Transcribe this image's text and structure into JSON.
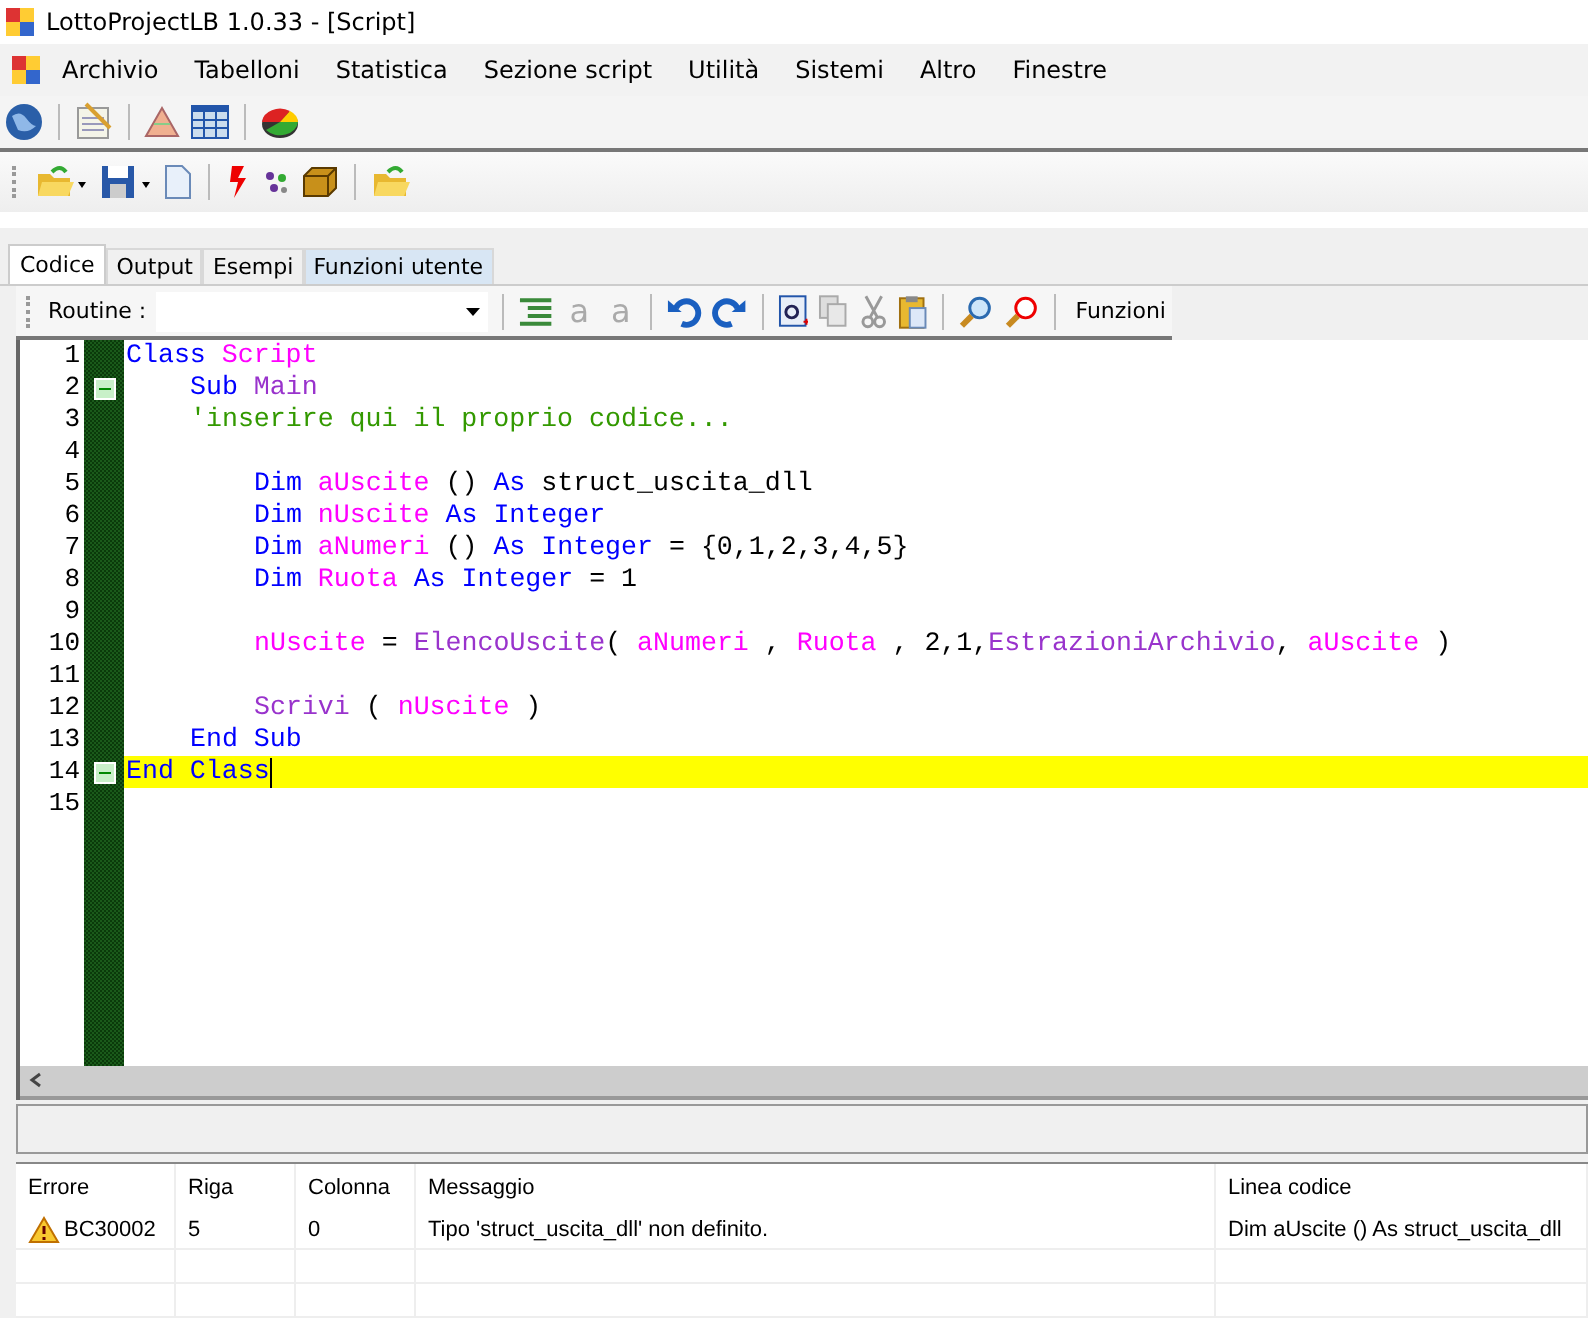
{
  "window": {
    "title": "LottoProjectLB 1.0.33 - [Script]"
  },
  "menu": [
    "Archivio",
    "Tabelloni",
    "Statistica",
    "Sezione script",
    "Utilità",
    "Sistemi",
    "Altro",
    "Finestre"
  ],
  "tabs": [
    {
      "label": "Codice",
      "selected": true,
      "highlighted": false
    },
    {
      "label": "Output",
      "selected": false,
      "highlighted": false
    },
    {
      "label": "Esempi",
      "selected": false,
      "highlighted": false
    },
    {
      "label": "Funzioni utente",
      "selected": false,
      "highlighted": true
    }
  ],
  "editor_toolbar": {
    "routine_label": "Routine :",
    "letter_buttons": [
      {
        "glyph": "a",
        "disabled": true
      },
      {
        "glyph": "a",
        "disabled": true
      }
    ],
    "functions_button": "Funzioni"
  },
  "editor": {
    "lines": [
      {
        "number": "1",
        "fold": false,
        "current": false,
        "tokens": [
          {
            "kind": "keyword",
            "text": "Class "
          },
          {
            "kind": "ident",
            "text": "Script"
          }
        ],
        "children": [
          {
            "number": "2",
            "fold": true,
            "current": false,
            "tokens": [
              {
                "kind": "keyword",
                "text": "Sub "
              },
              {
                "kind": "func",
                "text": "Main"
              }
            ]
          },
          {
            "number": "3",
            "fold": false,
            "current": false,
            "tokens": [
              {
                "kind": "comment",
                "text": "'inserire qui il proprio codice..."
              }
            ],
            "children": [
              {
                "number": "4",
                "fold": false,
                "current": false
              },
              {
                "number": "5",
                "fold": false,
                "current": false,
                "tokens": [
                  {
                    "kind": "keyword",
                    "text": "Dim "
                  },
                  {
                    "kind": "ident",
                    "text": "aUscite"
                  },
                  {
                    "kind": "plain",
                    "text": " () "
                  },
                  {
                    "kind": "keyword",
                    "text": "As "
                  },
                  {
                    "kind": "plain",
                    "text": "struct_uscita_dll"
                  }
                ]
              },
              {
                "number": "6",
                "fold": false,
                "current": false,
                "tokens": [
                  {
                    "kind": "keyword",
                    "text": "Dim "
                  },
                  {
                    "kind": "ident",
                    "text": "nUscite "
                  },
                  {
                    "kind": "keyword",
                    "text": "As Integer"
                  }
                ]
              },
              {
                "number": "7",
                "fold": false,
                "current": false,
                "tokens": [
                  {
                    "kind": "keyword",
                    "text": "Dim "
                  },
                  {
                    "kind": "ident",
                    "text": "aNumeri"
                  },
                  {
                    "kind": "plain",
                    "text": " () "
                  },
                  {
                    "kind": "keyword",
                    "text": "As Integer"
                  },
                  {
                    "kind": "plain",
                    "text": " = {0,1,2,3,4,5}"
                  }
                ]
              },
              {
                "number": "8",
                "fold": false,
                "current": false,
                "tokens": [
                  {
                    "kind": "keyword",
                    "text": "Dim "
                  },
                  {
                    "kind": "ident",
                    "text": "Ruota "
                  },
                  {
                    "kind": "keyword",
                    "text": "As Integer"
                  },
                  {
                    "kind": "plain",
                    "text": " = 1"
                  }
                ]
              },
              {
                "number": "9",
                "fold": false,
                "current": false
              },
              {
                "number": "10",
                "fold": false,
                "current": false,
                "tokens": [
                  {
                    "kind": "ident",
                    "text": "nUscite"
                  },
                  {
                    "kind": "plain",
                    "text": " = "
                  },
                  {
                    "kind": "func",
                    "text": "ElencoUscite"
                  },
                  {
                    "kind": "plain",
                    "text": "( "
                  },
                  {
                    "kind": "ident",
                    "text": "aNumeri"
                  },
                  {
                    "kind": "plain",
                    "text": " , "
                  },
                  {
                    "kind": "ident",
                    "text": "Ruota"
                  },
                  {
                    "kind": "plain",
                    "text": " , 2,1,"
                  },
                  {
                    "kind": "func",
                    "text": "EstrazioniArchivio"
                  },
                  {
                    "kind": "plain",
                    "text": ", "
                  },
                  {
                    "kind": "ident",
                    "text": "aUscite"
                  },
                  {
                    "kind": "plain",
                    "text": " )"
                  }
                ]
              },
              {
                "number": "11",
                "fold": false,
                "current": false
              },
              {
                "number": "12",
                "fold": false,
                "current": false,
                "tokens": [
                  {
                    "kind": "func",
                    "text": "Scrivi"
                  },
                  {
                    "kind": "plain",
                    "text": " ( "
                  },
                  {
                    "kind": "ident",
                    "text": "nUscite"
                  },
                  {
                    "kind": "plain",
                    "text": " )"
                  }
                ]
              }
            ]
          },
          {
            "number": "13",
            "fold": false,
            "current": false,
            "tokens": [
              {
                "kind": "keyword",
                "text": "End Sub"
              }
            ]
          }
        ]
      },
      {
        "number": "14",
        "fold": true,
        "current": true,
        "tokens": [
          {
            "kind": "keyword",
            "text": "End Class"
          }
        ]
      },
      {
        "number": "15",
        "fold": false,
        "current": false
      }
    ]
  },
  "error_list": {
    "columns": [
      "Errore",
      "Riga",
      "Colonna",
      "Messaggio",
      "Linea codice"
    ],
    "rows": [
      {
        "warning": true,
        "cells": [
          "BC30002",
          "5",
          "0",
          "Tipo 'struct_uscita_dll' non definito.",
          "Dim aUscite () As struct_uscita_dll"
        ]
      }
    ]
  }
}
